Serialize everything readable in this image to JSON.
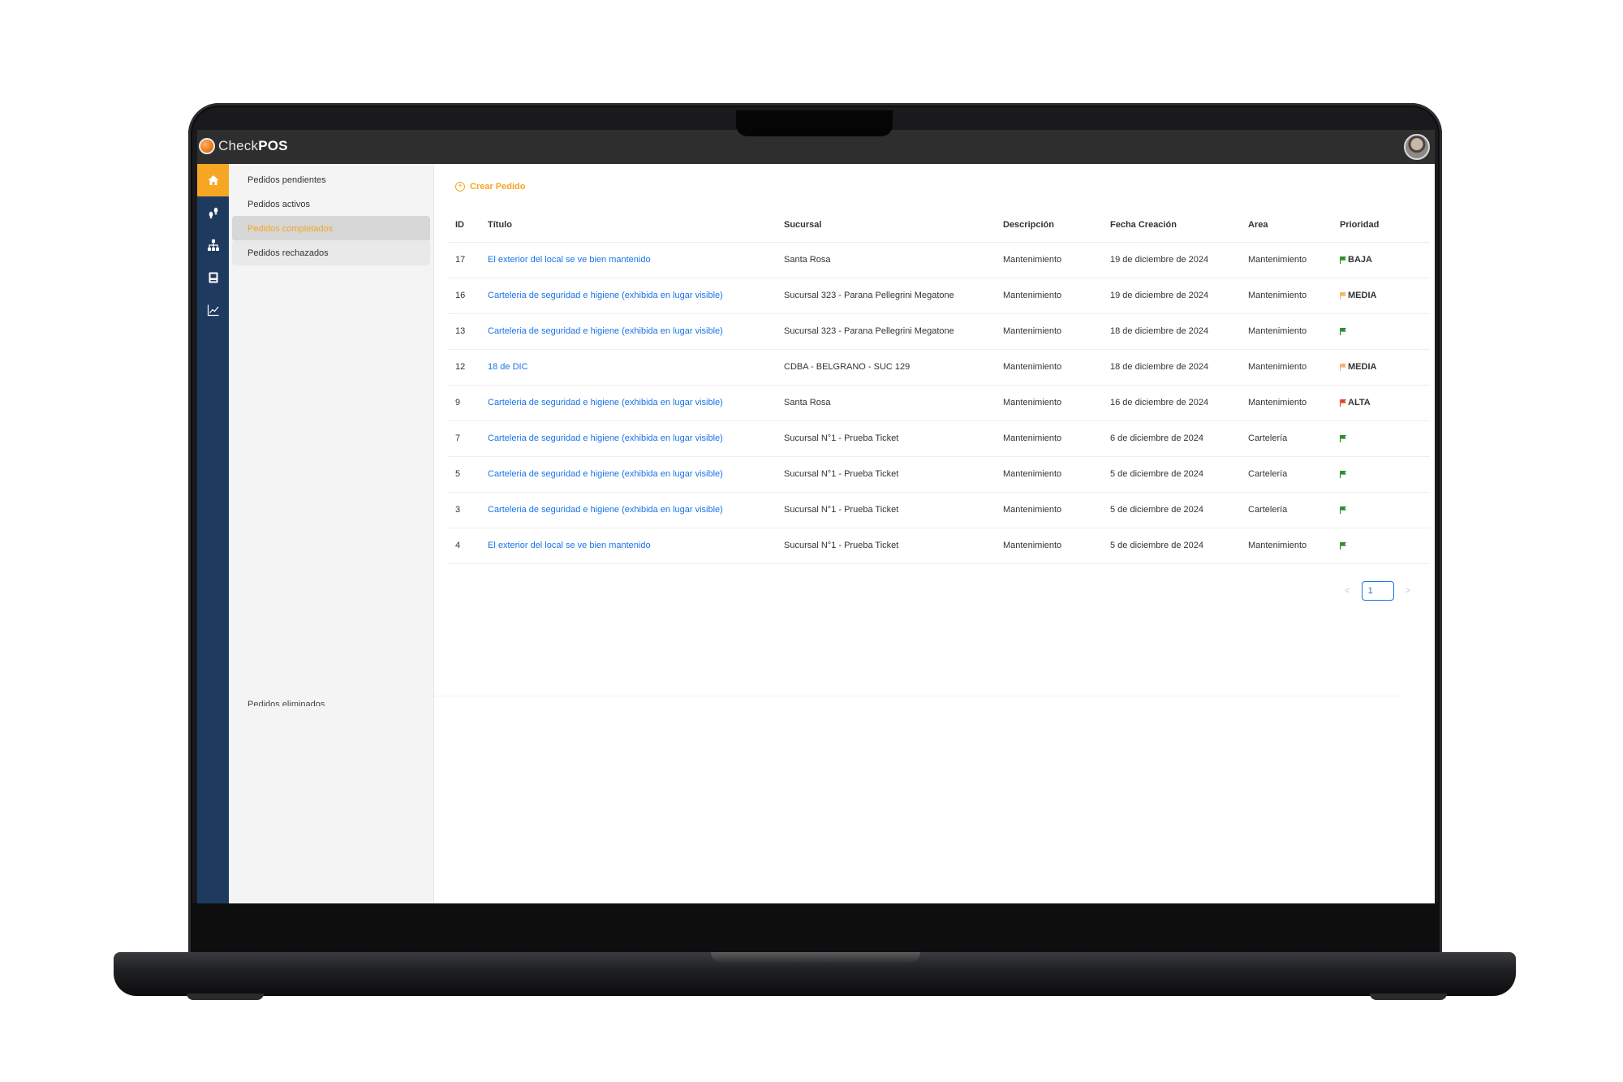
{
  "app": {
    "brand_light": "Check",
    "brand_bold": "POS"
  },
  "rail": [
    {
      "icon": "home-icon",
      "active": true
    },
    {
      "icon": "footprints-icon",
      "active": false
    },
    {
      "icon": "org-chart-icon",
      "active": false
    },
    {
      "icon": "book-icon",
      "active": false
    },
    {
      "icon": "line-chart-icon",
      "active": false
    }
  ],
  "subnav": {
    "items": [
      {
        "label": "Pedidos pendientes"
      },
      {
        "label": "Pedidos activos"
      },
      {
        "label": "Pedidos completados"
      },
      {
        "label": "Pedidos rechazados"
      }
    ],
    "deleted_label": "Pedidos eliminados"
  },
  "main": {
    "create_label": "Crear Pedido",
    "columns": [
      "ID",
      "Título",
      "Sucursal",
      "Descripción",
      "Fecha Creación",
      "Area",
      "Prioridad"
    ],
    "rows": [
      {
        "id": "17",
        "title": "El exterior del local se ve bien mantenido",
        "sucursal": "Santa Rosa",
        "descripcion": "Mantenimiento",
        "fecha": "19 de diciembre de 2024",
        "area": "Mantenimiento",
        "prioridad": "BAJA",
        "flag": "#2e8b2e"
      },
      {
        "id": "16",
        "title": "Carteleria de seguridad e higiene (exhibida en lugar visible)",
        "sucursal": "Sucursal 323 - Parana Pellegrini Megatone",
        "descripcion": "Mantenimiento",
        "fecha": "19 de diciembre de 2024",
        "area": "Mantenimiento",
        "prioridad": "MEDIA",
        "flag": "#f5b26b"
      },
      {
        "id": "13",
        "title": "Carteleria de seguridad e higiene (exhibida en lugar visible)",
        "sucursal": "Sucursal 323 - Parana Pellegrini Megatone",
        "descripcion": "Mantenimiento",
        "fecha": "18 de diciembre de 2024",
        "area": "Mantenimiento",
        "prioridad": "",
        "flag": "#2e8b2e"
      },
      {
        "id": "12",
        "title": "18 de DIC",
        "sucursal": "CDBA - BELGRANO - SUC 129",
        "descripcion": "Mantenimiento",
        "fecha": "18 de diciembre de 2024",
        "area": "Mantenimiento",
        "prioridad": "MEDIA",
        "flag": "#f5b26b"
      },
      {
        "id": "9",
        "title": "Carteleria de seguridad e higiene (exhibida en lugar visible)",
        "sucursal": "Santa Rosa",
        "descripcion": "Mantenimiento",
        "fecha": "16 de diciembre de 2024",
        "area": "Mantenimiento",
        "prioridad": "ALTA",
        "flag": "#e8431f"
      },
      {
        "id": "7",
        "title": "Carteleria de seguridad e higiene (exhibida en lugar visible)",
        "sucursal": "Sucursal N°1 - Prueba Ticket",
        "descripcion": "Mantenimiento",
        "fecha": "6 de diciembre de 2024",
        "area": "Cartelería",
        "prioridad": "",
        "flag": "#2e8b2e"
      },
      {
        "id": "5",
        "title": "Carteleria de seguridad e higiene (exhibida en lugar visible)",
        "sucursal": "Sucursal N°1 - Prueba Ticket",
        "descripcion": "Mantenimiento",
        "fecha": "5 de diciembre de 2024",
        "area": "Cartelería",
        "prioridad": "",
        "flag": "#2e8b2e"
      },
      {
        "id": "3",
        "title": "Carteleria de seguridad e higiene (exhibida en lugar visible)",
        "sucursal": "Sucursal N°1 - Prueba Ticket",
        "descripcion": "Mantenimiento",
        "fecha": "5 de diciembre de 2024",
        "area": "Cartelería",
        "prioridad": "",
        "flag": "#2e8b2e"
      },
      {
        "id": "4",
        "title": "El exterior del local se ve bien mantenido",
        "sucursal": "Sucursal N°1 - Prueba Ticket",
        "descripcion": "Mantenimiento",
        "fecha": "5 de diciembre de 2024",
        "area": "Mantenimiento",
        "prioridad": "",
        "flag": "#2e8b2e"
      }
    ],
    "pagination": {
      "prev": "<",
      "current": "1",
      "next": ">"
    }
  },
  "colors": {
    "accent": "#f5a623",
    "rail": "#1f3a5f",
    "link": "#1a73e8"
  }
}
